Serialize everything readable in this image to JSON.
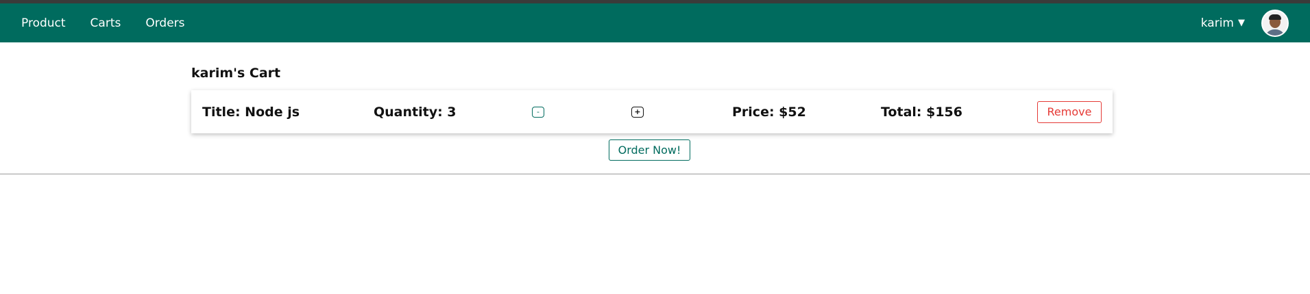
{
  "navbar": {
    "links": [
      "Product",
      "Carts",
      "Orders"
    ],
    "user_name": "karim",
    "caret": "▼",
    "brand_color": "#006b5e"
  },
  "cart": {
    "title": "karim's Cart",
    "items": [
      {
        "title": "Title: Node js",
        "quantity": "Quantity: 3",
        "minus_label": "-",
        "plus_label": "+",
        "price": "Price: $52",
        "total": "Total: $156",
        "remove_label": "Remove"
      }
    ],
    "order_label": "Order Now!"
  },
  "colors": {
    "danger": "#e53935",
    "accent": "#006b5e"
  }
}
